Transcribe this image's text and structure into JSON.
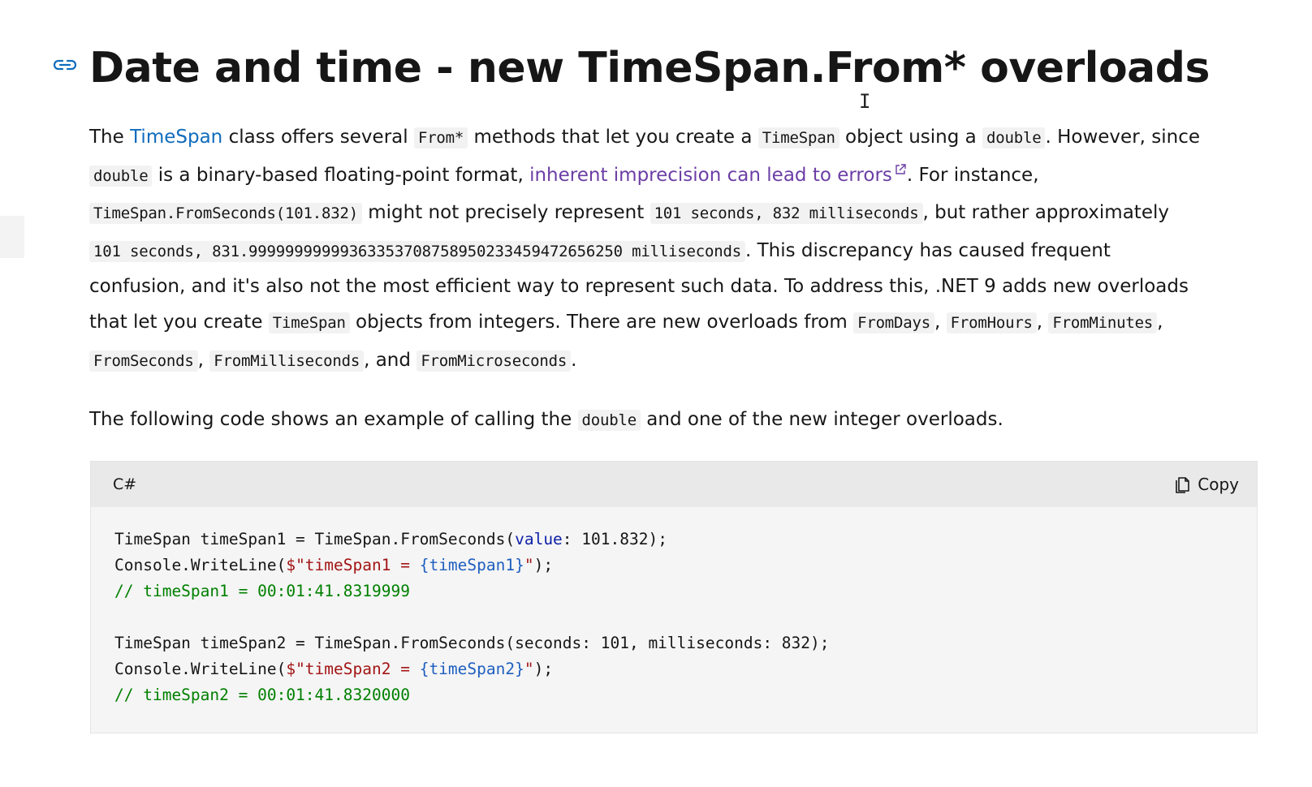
{
  "heading": "Date and time - new TimeSpan.From* overloads",
  "paragraph1": {
    "l1_t1": "The ",
    "l1_link": "TimeSpan",
    "l1_t2": " class offers several ",
    "l1_c1": "From*",
    "l1_t3": " methods that let you create a ",
    "l1_c2": "TimeSpan",
    "l1_t4": " object using a ",
    "l1_c3": "double",
    "l1_t5": ". However, since",
    "l2_c1": "double",
    "l2_t1": " is a binary-based floating-point format, ",
    "l2_link": "inherent imprecision can lead to errors",
    "l2_t2": ". For instance,",
    "l3_c1": "TimeSpan.FromSeconds(101.832)",
    "l3_t1": " might not precisely represent ",
    "l3_c2": "101 seconds, 832 milliseconds",
    "l3_t2": ", but rather approximately",
    "l4_c1": "101 seconds, 831.99999999999363353708758950233459472656250 milliseconds",
    "l4_t1": ". This discrepancy has caused frequent",
    "l5_t1": "confusion, and it's also not the most efficient way to represent such data. To address this, .NET 9 adds new overloads",
    "l6_t1": "that let you create ",
    "l6_c1": "TimeSpan",
    "l6_t2": " objects from integers. There are new overloads from ",
    "l6_c2": "FromDays",
    "l6_t3": ", ",
    "l6_c3": "FromHours",
    "l6_t4": ", ",
    "l6_c4": "FromMinutes",
    "l6_t5": ",",
    "l7_c1": "FromSeconds",
    "l7_t1": ", ",
    "l7_c2": "FromMilliseconds",
    "l7_t2": ", and ",
    "l7_c3": "FromMicroseconds",
    "l7_t3": "."
  },
  "paragraph2": {
    "t1": "The following code shows an example of calling the ",
    "c1": "double",
    "t2": " and one of the new integer overloads."
  },
  "code_block": {
    "language": "C#",
    "copy_label": "Copy",
    "lines": {
      "l1_a": "TimeSpan timeSpan1 = TimeSpan.FromSeconds(",
      "l1_kw": "value",
      "l1_b": ": 101.832);",
      "l2_a": "Console.WriteLine(",
      "l2_s1": "$\"timeSpan1 = ",
      "l2_i": "{timeSpan1}",
      "l2_s2": "\"",
      "l2_b": ");",
      "l3_cmt": "// timeSpan1 = 00:01:41.8319999",
      "l5_a": "TimeSpan timeSpan2 = TimeSpan.FromSeconds(seconds: 101, milliseconds: 832);",
      "l6_a": "Console.WriteLine(",
      "l6_s1": "$\"timeSpan2 = ",
      "l6_i": "{timeSpan2}",
      "l6_s2": "\"",
      "l6_b": ");",
      "l7_cmt": "// timeSpan2 = 00:01:41.8320000"
    }
  },
  "icons": {
    "anchor": "link-icon",
    "external": "external-link-icon",
    "copy": "copy-icon"
  },
  "colors": {
    "link": "#0f6cbd",
    "visited_link": "#6b3ea5",
    "keyword": "#0d1fa8",
    "string": "#a31515",
    "comment": "#008000"
  }
}
